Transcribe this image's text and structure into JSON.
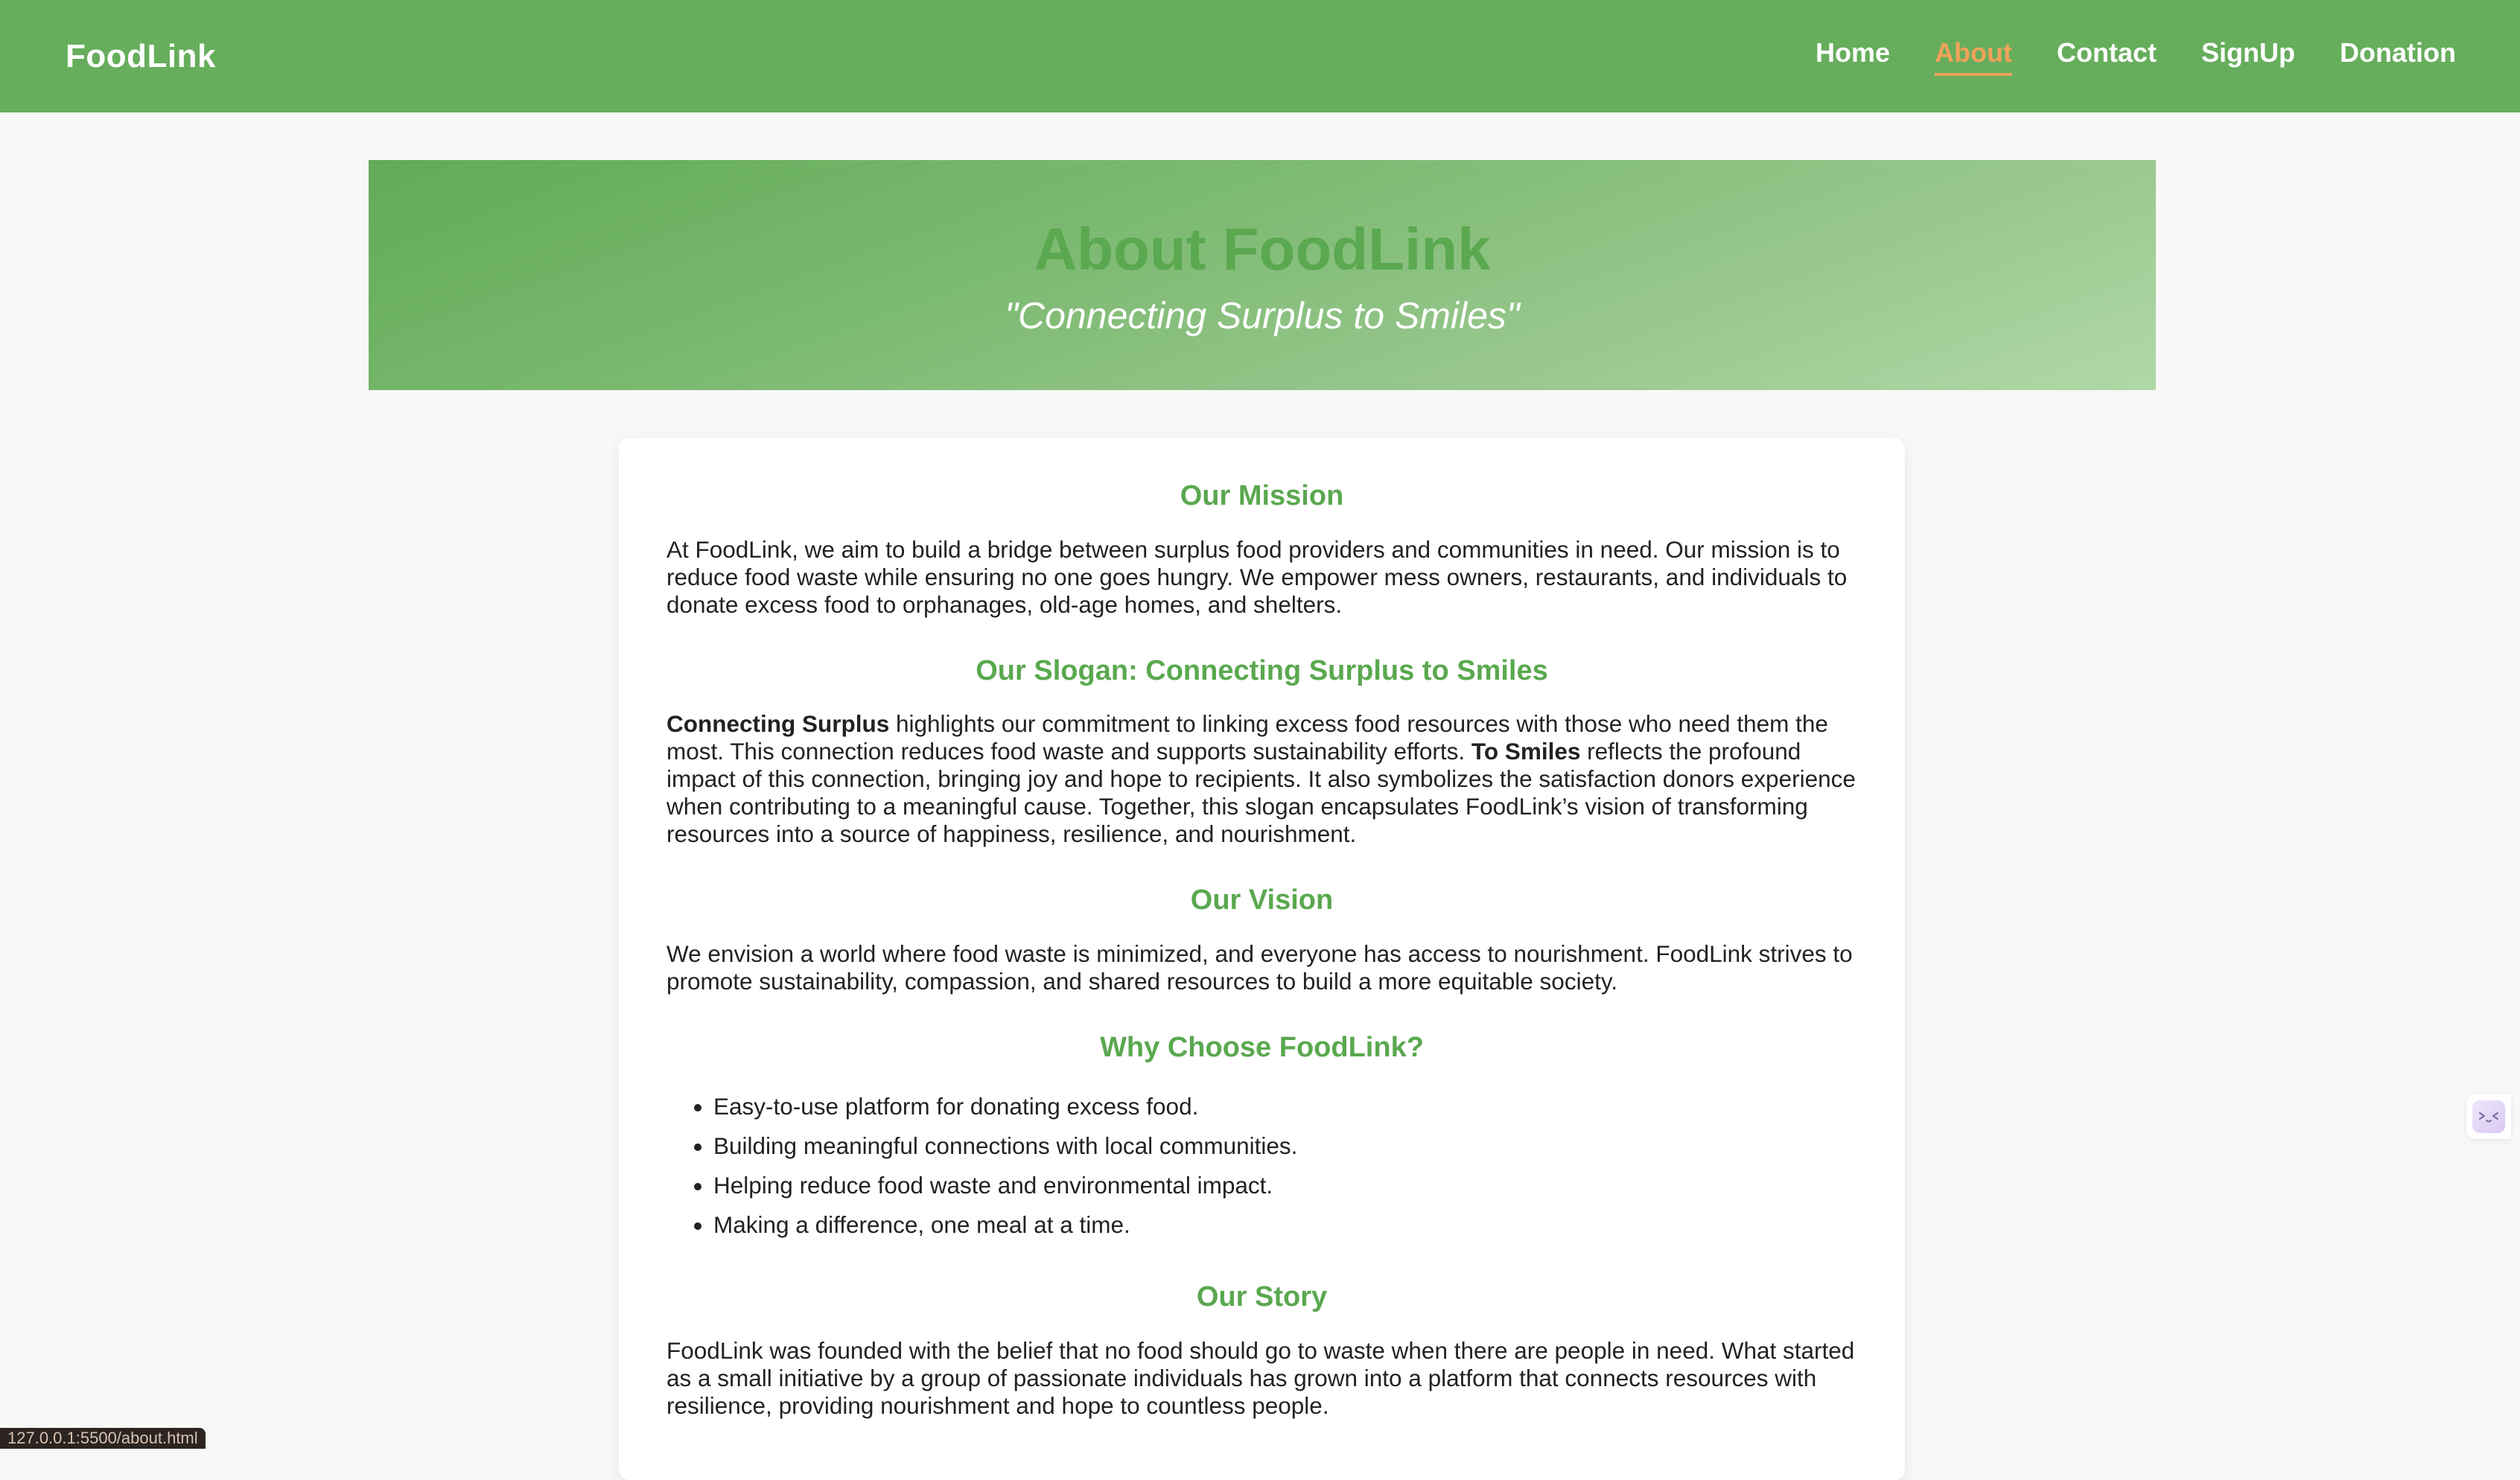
{
  "nav": {
    "brand": "FoodLink",
    "links": [
      "Home",
      "About",
      "Contact",
      "SignUp",
      "Donation"
    ],
    "active": "About",
    "active_color": "#f1a25b",
    "bg_color": "#66ad5c"
  },
  "hero": {
    "title": "About FoodLink",
    "slogan": "\"Connecting Surplus to Smiles\""
  },
  "sections": {
    "mission": {
      "heading": "Our Mission",
      "text": "At FoodLink, we aim to build a bridge between surplus food providers and communities in need. Our mission is to reduce food waste while ensuring no one goes hungry. We empower mess owners, restaurants, and individuals to donate excess food to orphanages, old-age homes, and shelters."
    },
    "slogan": {
      "heading": "Our Slogan: Connecting Surplus to Smiles",
      "bold1": "Connecting Surplus",
      "text1": " highlights our commitment to linking excess food resources with those who need them the most. This connection reduces food waste and supports sustainability efforts. ",
      "bold2": "To Smiles",
      "text2": " reflects the profound impact of this connection, bringing joy and hope to recipients. It also symbolizes the satisfaction donors experience when contributing to a meaningful cause. Together, this slogan encapsulates FoodLink’s vision of transforming resources into a source of happiness, resilience, and nourishment."
    },
    "vision": {
      "heading": "Our Vision",
      "text": "We envision a world where food waste is minimized, and everyone has access to nourishment. FoodLink strives to promote sustainability, compassion, and shared resources to build a more equitable society."
    },
    "why": {
      "heading": "Why Choose FoodLink?",
      "items": [
        "Easy-to-use platform for donating excess food.",
        "Building meaningful connections with local communities.",
        "Helping reduce food waste and environmental impact.",
        "Making a difference, one meal at a time."
      ]
    },
    "story": {
      "heading": "Our Story",
      "text": "FoodLink was founded with the belief that no food should go to waste when there are people in need. What started as a small initiative by a group of passionate individuals has grown into a platform that connects resources with resilience, providing nourishment and hope to countless people."
    }
  },
  "status_bar": {
    "url": "127.0.0.1:5500/about.html"
  },
  "widget": {
    "icon": "extension-face-icon"
  }
}
